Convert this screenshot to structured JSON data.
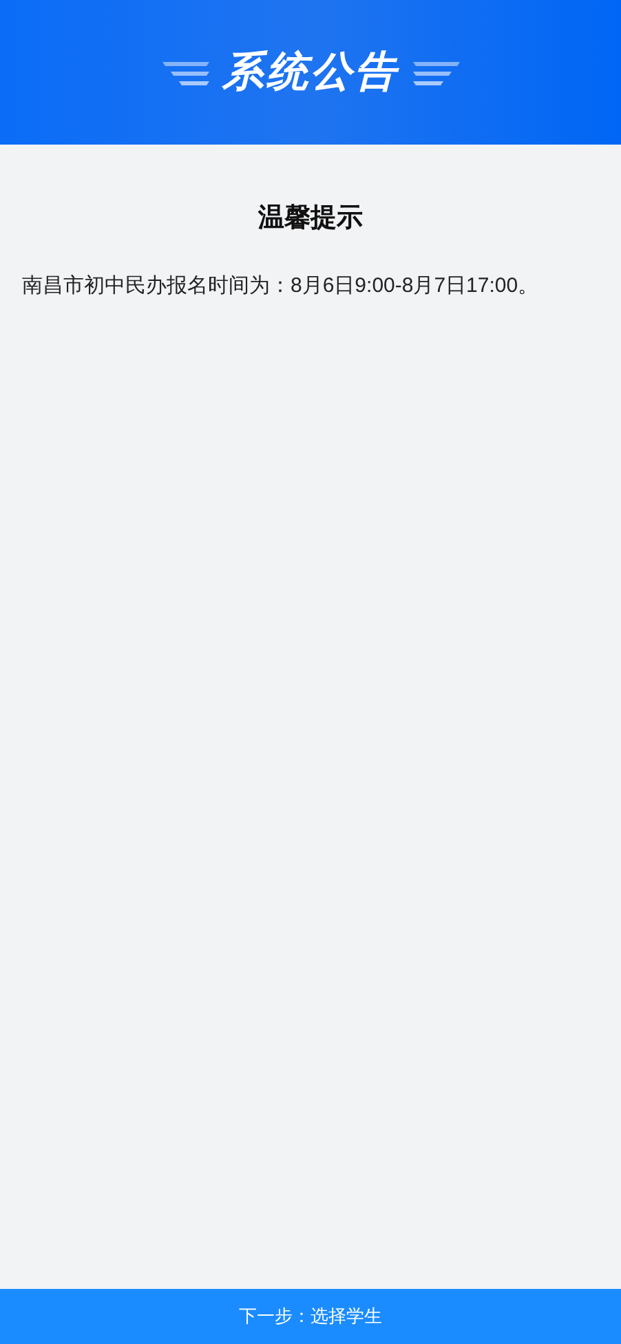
{
  "header": {
    "title": "系统公告"
  },
  "notice": {
    "title": "温馨提示",
    "body": "南昌市初中民办报名时间为：8月6日9:00-8月7日17:00。"
  },
  "next_button": {
    "label": "下一步：选择学生"
  }
}
